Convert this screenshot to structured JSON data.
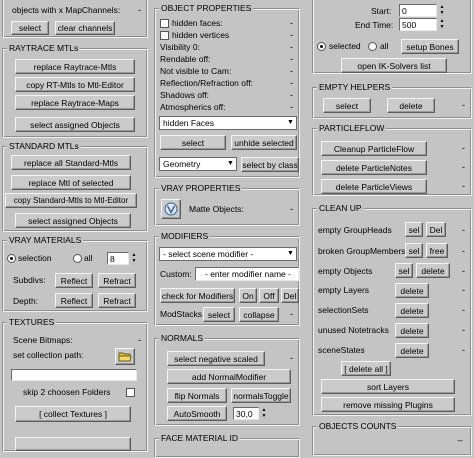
{
  "col1": {
    "top": {
      "objects_with_mapchannels": "objects with x MapChannels:",
      "select": "select",
      "clear_channels": "clear channels"
    },
    "raytrace": {
      "title": "RAYTRACE MTLs",
      "replace_raytrace_mtls": "replace Raytrace-Mtls",
      "copy_rt_mtls": "copy RT-Mtls to Mtl-Editor",
      "replace_raytrace_maps": "replace Raytrace-Maps",
      "select_assigned": "select assigned Objects"
    },
    "standard": {
      "title": "STANDARD MTLs",
      "replace_all": "replace all Standard-Mtls",
      "replace_selected": "replace Mtl of selected",
      "copy_standard": "copy Standard-Mtls to Mtl-Editor",
      "select_assigned": "select assigned Objects"
    },
    "vray_materials": {
      "title": "VRAY MATERIALS",
      "selection": "selection",
      "all": "all",
      "number": "8",
      "subdivs": "Subdivs:",
      "depth": "Depth:",
      "reflect": "Reflect",
      "refract": "Refract"
    },
    "textures": {
      "title": "TEXTURES",
      "scene_bitmaps": "Scene Bitmaps:",
      "set_collection_path": "set collection path:",
      "skip_folders": "skip 2 choosen Folders",
      "collect_textures": "[ collect Textures ]"
    }
  },
  "col2": {
    "object_properties": {
      "title": "OBJECT PROPERTIES",
      "hidden_faces": "hidden faces:",
      "hidden_vertices": "hidden vertices",
      "visibility": "Visibility 0:",
      "renderable": "Rendable off:",
      "not_visible": "Not visible to Cam:",
      "reflection": "Reflection/Refraction off:",
      "shadows": "Shadows off:",
      "atmospherics": "Atmospherics off:",
      "dropdown_value": "hidden Faces",
      "select": "select",
      "unhide_selected": "unhide selected",
      "class_value": "Geometry",
      "select_by_class": "select by class"
    },
    "vray_properties": {
      "title": "VRAY PROPERTIES",
      "matte_objects": "Matte Objects:"
    },
    "modifiers": {
      "title": "MODIFIERS",
      "select_modifier": "- select scene modifier -",
      "custom": "Custom:",
      "custom_placeholder": "- enter modifier name -",
      "check_modifiers": "check for Modifiers",
      "on": "On",
      "off": "Off",
      "del": "Del",
      "modstacks": "ModStacks",
      "select": "select",
      "collapse": "collapse"
    },
    "normals": {
      "title": "NORMALS",
      "select_negative": "select negative scaled",
      "add_normal": "add NormalModifier",
      "flip_normals": "flip Normals",
      "normals_toggle": "normalsToggle",
      "autosmooth": "AutoSmooth",
      "autosmooth_value": "30,0"
    },
    "face_material": {
      "title": "FACE MATERIAL ID"
    }
  },
  "col3": {
    "time": {
      "start_label": "Start:",
      "start_value": "0",
      "end_label": "End Time:",
      "end_value": "500",
      "selected": "selected",
      "all": "all",
      "setup_bones": "setup Bones",
      "open_ik": "open IK-Solvers list"
    },
    "empty_helpers": {
      "title": "EMPTY HELPERS",
      "select": "select",
      "delete": "delete"
    },
    "particleflow": {
      "title": "PARTICLEFLOW",
      "cleanup": "Cleanup ParticleFlow",
      "delete_notes": "delete ParticleNotes",
      "delete_views": "delete ParticleViews"
    },
    "cleanup": {
      "title": "CLEAN UP",
      "empty_groupheads": "empty GroupHeads",
      "broken_groupmembers": "broken GroupMembers",
      "empty_objects": "empty Objects",
      "empty_layers": "empty Layers",
      "selection_sets": "selectionSets",
      "unused_notetracks": "unused Notetracks",
      "scene_states": "sceneStates",
      "sel": "sel",
      "free": "free",
      "delete": "delete",
      "delete_all": "[ delete all ]",
      "sort_layers": "sort Layers",
      "remove_missing": "remove missing Plugins"
    },
    "objects_counts": {
      "title": "OBJECTS COUNTS"
    }
  },
  "dash": "-",
  "dash_dash": "--"
}
